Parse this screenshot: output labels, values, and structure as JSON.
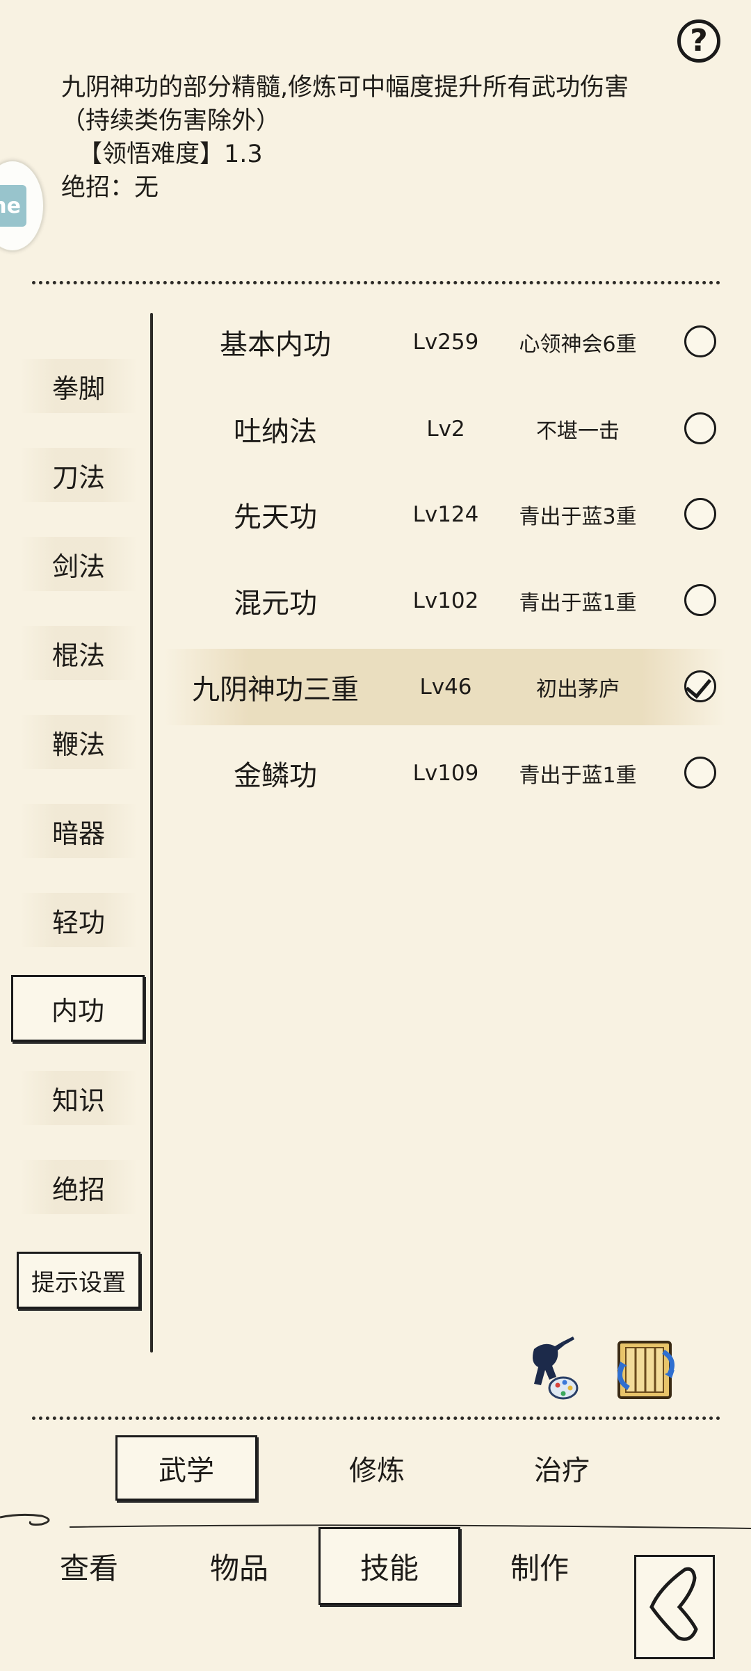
{
  "header": {
    "help_icon_text": "?",
    "description_line1": "九阴神功的部分精髓,修炼可中幅度提升所有武功伤害",
    "description_line2": "（持续类伤害除外）",
    "difficulty_label": "【领悟难度】1.3",
    "ultimate_label": "绝招：无"
  },
  "side_tab": {
    "text": "ne"
  },
  "categories": [
    {
      "label": "拳脚"
    },
    {
      "label": "刀法"
    },
    {
      "label": "剑法"
    },
    {
      "label": "棍法"
    },
    {
      "label": "鞭法"
    },
    {
      "label": "暗器"
    },
    {
      "label": "轻功"
    },
    {
      "label": "内功"
    },
    {
      "label": "知识"
    },
    {
      "label": "绝招"
    }
  ],
  "active_category": "内功",
  "hint_settings_label": "提示设置",
  "skills": [
    {
      "name": "基本内功",
      "level": "Lv259",
      "rank": "心领神会6重",
      "equipped": false
    },
    {
      "name": "吐纳法",
      "level": "Lv2",
      "rank": "不堪一击",
      "equipped": false
    },
    {
      "name": "先天功",
      "level": "Lv124",
      "rank": "青出于蓝3重",
      "equipped": false
    },
    {
      "name": "混元功",
      "level": "Lv102",
      "rank": "青出于蓝1重",
      "equipped": false
    },
    {
      "name": "九阴神功三重",
      "level": "Lv46",
      "rank": "初出茅庐",
      "equipped": true
    },
    {
      "name": "金鳞功",
      "level": "Lv109",
      "rank": "青出于蓝1重",
      "equipped": false
    }
  ],
  "action_icons": [
    "martial-artist-palette-icon",
    "scroll-swap-icon"
  ],
  "sub_tabs": [
    {
      "label": "武学",
      "active": true
    },
    {
      "label": "修炼",
      "active": false
    },
    {
      "label": "治疗",
      "active": false
    }
  ],
  "bottom_nav": [
    {
      "label": "查看",
      "active": false
    },
    {
      "label": "物品",
      "active": false
    },
    {
      "label": "技能",
      "active": true
    },
    {
      "label": "制作",
      "active": false
    }
  ],
  "back_icon": "back-arrow-icon",
  "colors": {
    "background": "#f8f2e2",
    "ink": "#1d1b18",
    "highlight": "#e8dab9",
    "side_tab_accent": "#98c4cc"
  }
}
